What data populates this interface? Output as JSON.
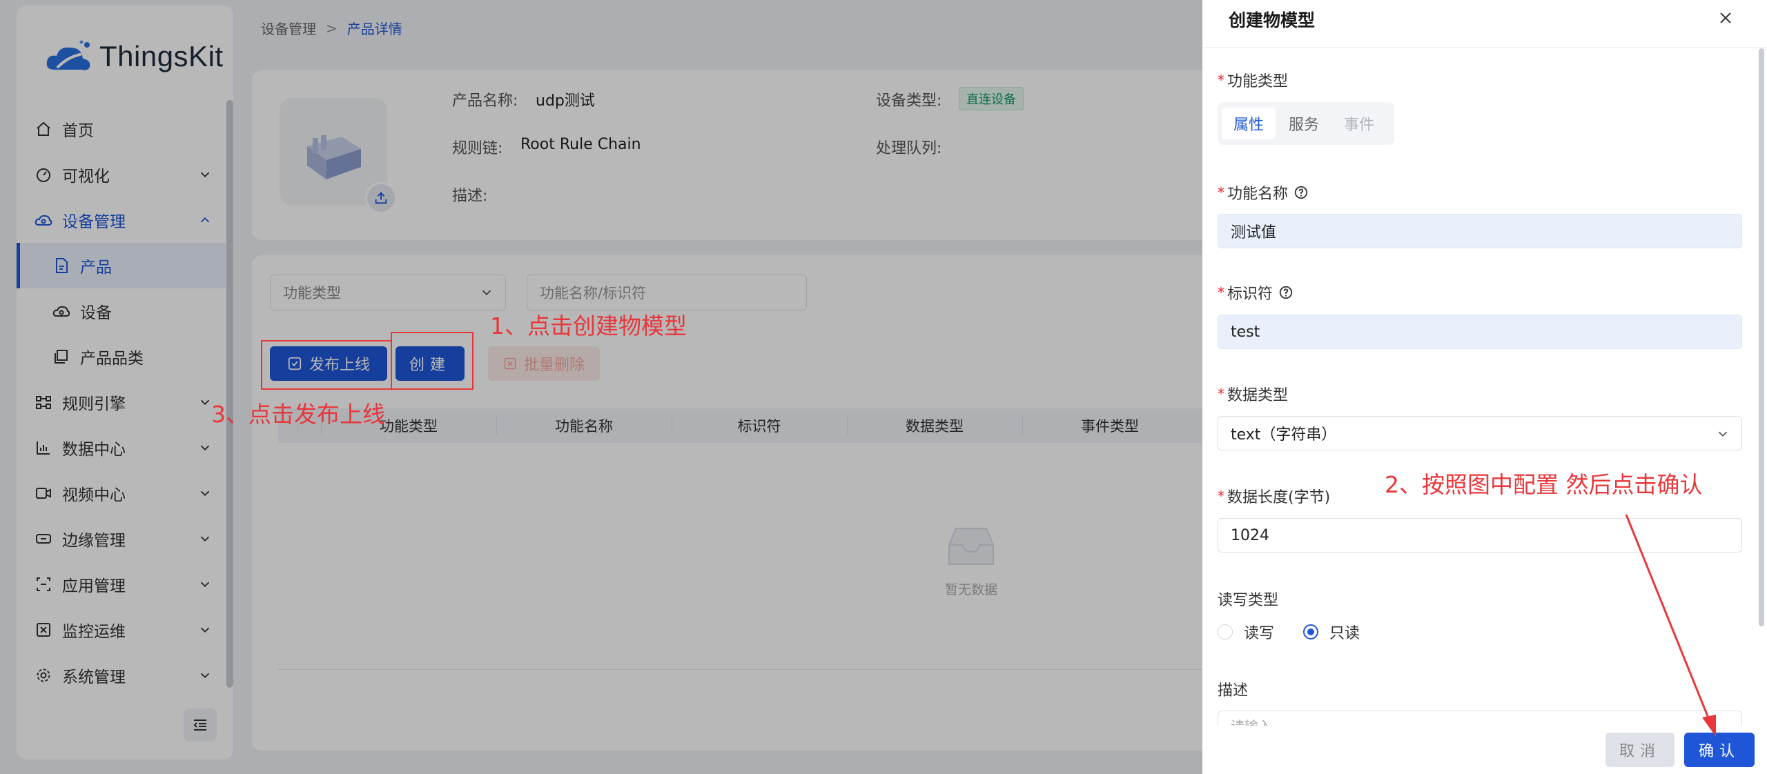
{
  "app": {
    "logo_text": "ThingsKit"
  },
  "sidebar": {
    "items": [
      {
        "label": "首页",
        "icon": "home-icon"
      },
      {
        "label": "可视化",
        "icon": "dashboard-icon"
      },
      {
        "label": "设备管理",
        "icon": "cloud-device-icon"
      },
      {
        "label": "产品",
        "icon": "file-icon"
      },
      {
        "label": "设备",
        "icon": "cloud-icon"
      },
      {
        "label": "产品品类",
        "icon": "category-icon"
      },
      {
        "label": "规则引擎",
        "icon": "rule-icon"
      },
      {
        "label": "数据中心",
        "icon": "chart-icon"
      },
      {
        "label": "视频中心",
        "icon": "video-icon"
      },
      {
        "label": "边缘管理",
        "icon": "edge-icon"
      },
      {
        "label": "应用管理",
        "icon": "app-icon"
      },
      {
        "label": "监控运维",
        "icon": "monitor-icon"
      },
      {
        "label": "系统管理",
        "icon": "gear-icon"
      }
    ]
  },
  "breadcrumb": {
    "parent": "设备管理",
    "separator": ">",
    "current": "产品详情"
  },
  "product": {
    "name_label": "产品名称:",
    "name_value": "udp测试",
    "device_type_label": "设备类型:",
    "device_type_value": "直连设备",
    "rule_chain_label": "规则链:",
    "rule_chain_value": "Root Rule Chain",
    "queue_label": "处理队列:",
    "desc_label": "描述:"
  },
  "list": {
    "filter_placeholder": "功能类型",
    "search_placeholder": "功能名称/标识符",
    "publish_label": "发布上线",
    "create_label": "创建",
    "batch_delete_label": "批量删除",
    "columns": [
      "功能类型",
      "功能名称",
      "标识符",
      "数据类型",
      "事件类型"
    ],
    "empty_text": "暂无数据"
  },
  "drawer": {
    "title": "创建物模型",
    "func_type_label": "功能类型",
    "func_type_options": [
      "属性",
      "服务",
      "事件"
    ],
    "func_name_label": "功能名称",
    "func_name_value": "测试值",
    "identifier_label": "标识符",
    "identifier_value": "test",
    "data_type_label": "数据类型",
    "data_type_value": "text（字符串）",
    "data_length_label": "数据长度(字节)",
    "data_length_value": "1024",
    "rw_label": "读写类型",
    "rw_options": [
      "读写",
      "只读"
    ],
    "rw_selected": "只读",
    "desc_label": "描述",
    "desc_placeholder": "请输入",
    "cancel_label": "取消",
    "ok_label": "确认",
    "required_mark": "*"
  },
  "annotations": {
    "step1": "1、点击创建物模型",
    "step2": "2、按照图中配置 然后点击确认",
    "step3": "3、点击发布上线"
  },
  "colors": {
    "primary": "#1f56d8",
    "annotation": "#e8373b",
    "success": "#1a9b6d"
  }
}
